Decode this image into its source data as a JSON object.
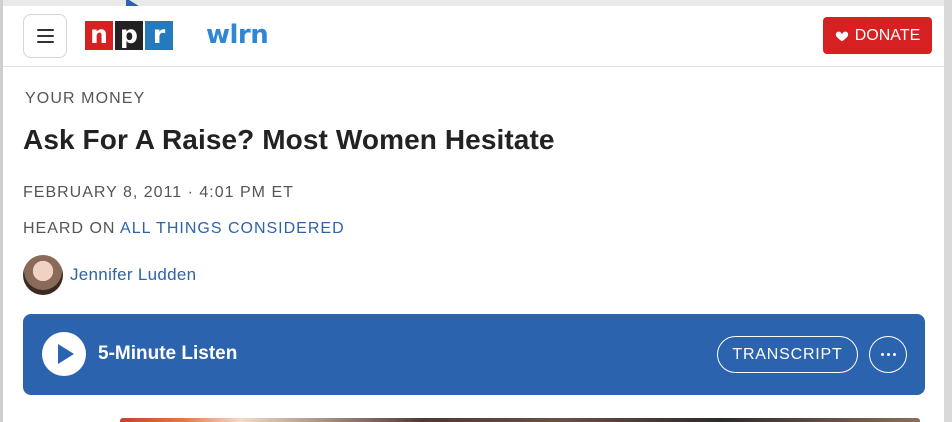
{
  "header": {
    "menu_icon": "hamburger-menu-icon",
    "npr_logo": {
      "letters": [
        "n",
        "p",
        "r"
      ],
      "colors": [
        "#d62021",
        "#222222",
        "#237bbd"
      ]
    },
    "station_logo": "wlrn",
    "donate": {
      "label": "DONATE",
      "icon": "heart-icon",
      "color": "#d62021"
    }
  },
  "article": {
    "section": "YOUR MONEY",
    "title": "Ask For A Raise? Most Women Hesitate",
    "dateline": "FEBRUARY 8, 2011 · 4:01 PM ET",
    "heard_on_prefix": "HEARD ON",
    "program": "ALL THINGS CONSIDERED",
    "author": "Jennifer Ludden"
  },
  "player": {
    "label": "5-Minute Listen",
    "transcript_label": "TRANSCRIPT",
    "play_icon": "play-icon",
    "more_icon": "more-options-icon",
    "color": "#2b63ae"
  }
}
